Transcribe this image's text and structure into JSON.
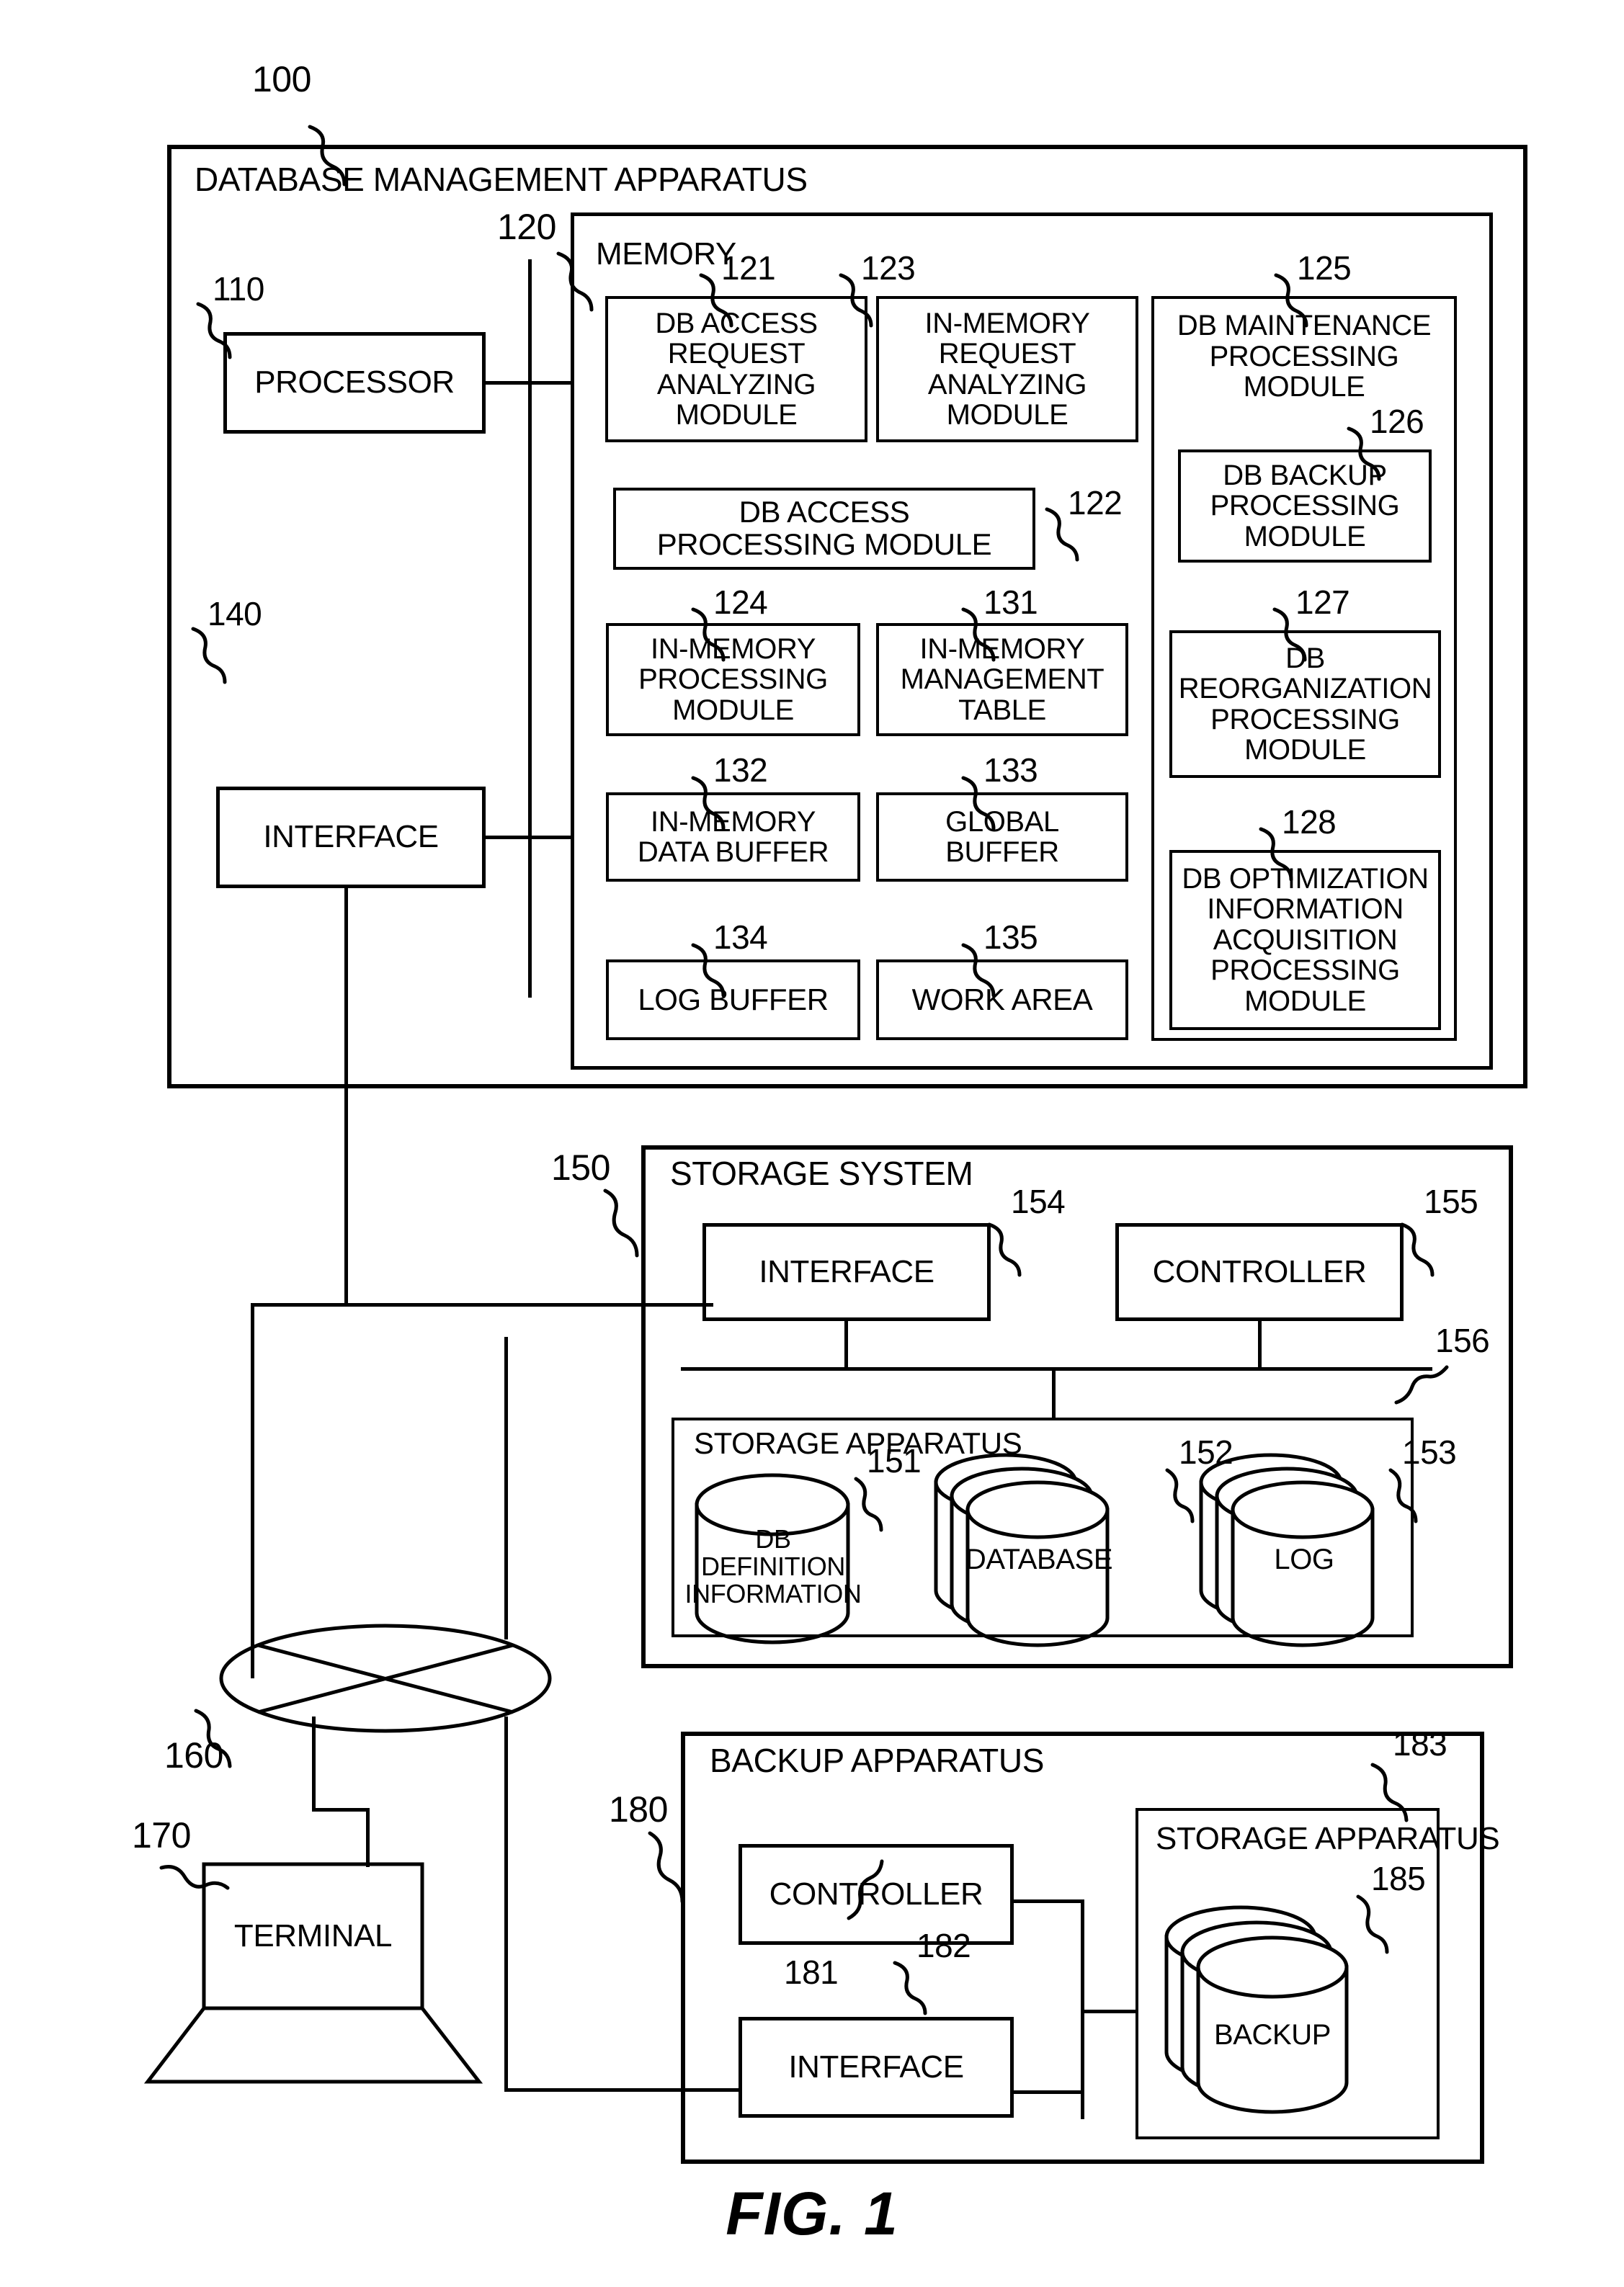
{
  "figure": {
    "caption": "FIG. 1",
    "title": "DATABASE MANAGEMENT APPARATUS"
  },
  "apparatus": {
    "label": "DATABASE MANAGEMENT APPARATUS",
    "ref": "100",
    "processor": {
      "label": "PROCESSOR",
      "ref": "110"
    },
    "interface": {
      "label": "INTERFACE",
      "ref": "140"
    },
    "memory": {
      "label": "MEMORY",
      "ref": "120",
      "modules": [
        {
          "ref": "121",
          "label": "DB ACCESS\nREQUEST\nANALYZING\nMODULE"
        },
        {
          "ref": "123",
          "label": "IN-MEMORY\nREQUEST\nANALYZING\nMODULE"
        },
        {
          "ref": "125",
          "label": "DB MAINTENANCE\nPROCESSING\nMODULE"
        },
        {
          "ref": "126",
          "label": "DB BACKUP\nPROCESSING\nMODULE"
        },
        {
          "ref": "122",
          "label": "DB ACCESS\nPROCESSING MODULE"
        },
        {
          "ref": "124",
          "label": "IN-MEMORY\nPROCESSING\nMODULE"
        },
        {
          "ref": "131",
          "label": "IN-MEMORY\nMANAGEMENT\nTABLE"
        },
        {
          "ref": "127",
          "label": "DB\nREORGANIZATION\nPROCESSING\nMODULE"
        },
        {
          "ref": "132",
          "label": "IN-MEMORY\nDATA BUFFER"
        },
        {
          "ref": "133",
          "label": "GLOBAL\nBUFFER"
        },
        {
          "ref": "128",
          "label": "DB OPTIMIZATION\nINFORMATION\nACQUISITION\nPROCESSING\nMODULE"
        },
        {
          "ref": "134",
          "label": "LOG BUFFER"
        },
        {
          "ref": "135",
          "label": "WORK AREA"
        }
      ]
    }
  },
  "storage_system": {
    "label": "STORAGE SYSTEM",
    "ref": "150",
    "interface": {
      "label": "INTERFACE",
      "ref": "154"
    },
    "controller": {
      "label": "CONTROLLER",
      "ref": "155"
    },
    "bus_ref": "156",
    "storage_apparatus": {
      "label": "STORAGE\nAPPARATUS",
      "disks": [
        {
          "ref": "151",
          "label": "DB DEFINITION\nINFORMATION",
          "stacked": false
        },
        {
          "ref": "152",
          "label": "DATABASE",
          "stacked": true
        },
        {
          "ref": "153",
          "label": "LOG",
          "stacked": true
        }
      ]
    }
  },
  "backup_apparatus": {
    "label": "BACKUP APPARATUS",
    "ref": "180",
    "controller": {
      "label": "CONTROLLER",
      "ref": "181"
    },
    "interface": {
      "label": "INTERFACE",
      "ref": "182"
    },
    "storage_apparatus": {
      "label": "STORAGE\nAPPARATUS",
      "ref": "183",
      "disk": {
        "ref": "185",
        "label": "BACKUP",
        "stacked": true
      }
    }
  },
  "network": {
    "ref": "160",
    "name": "network-cloud"
  },
  "terminal": {
    "ref": "170",
    "label": "TERMINAL"
  }
}
